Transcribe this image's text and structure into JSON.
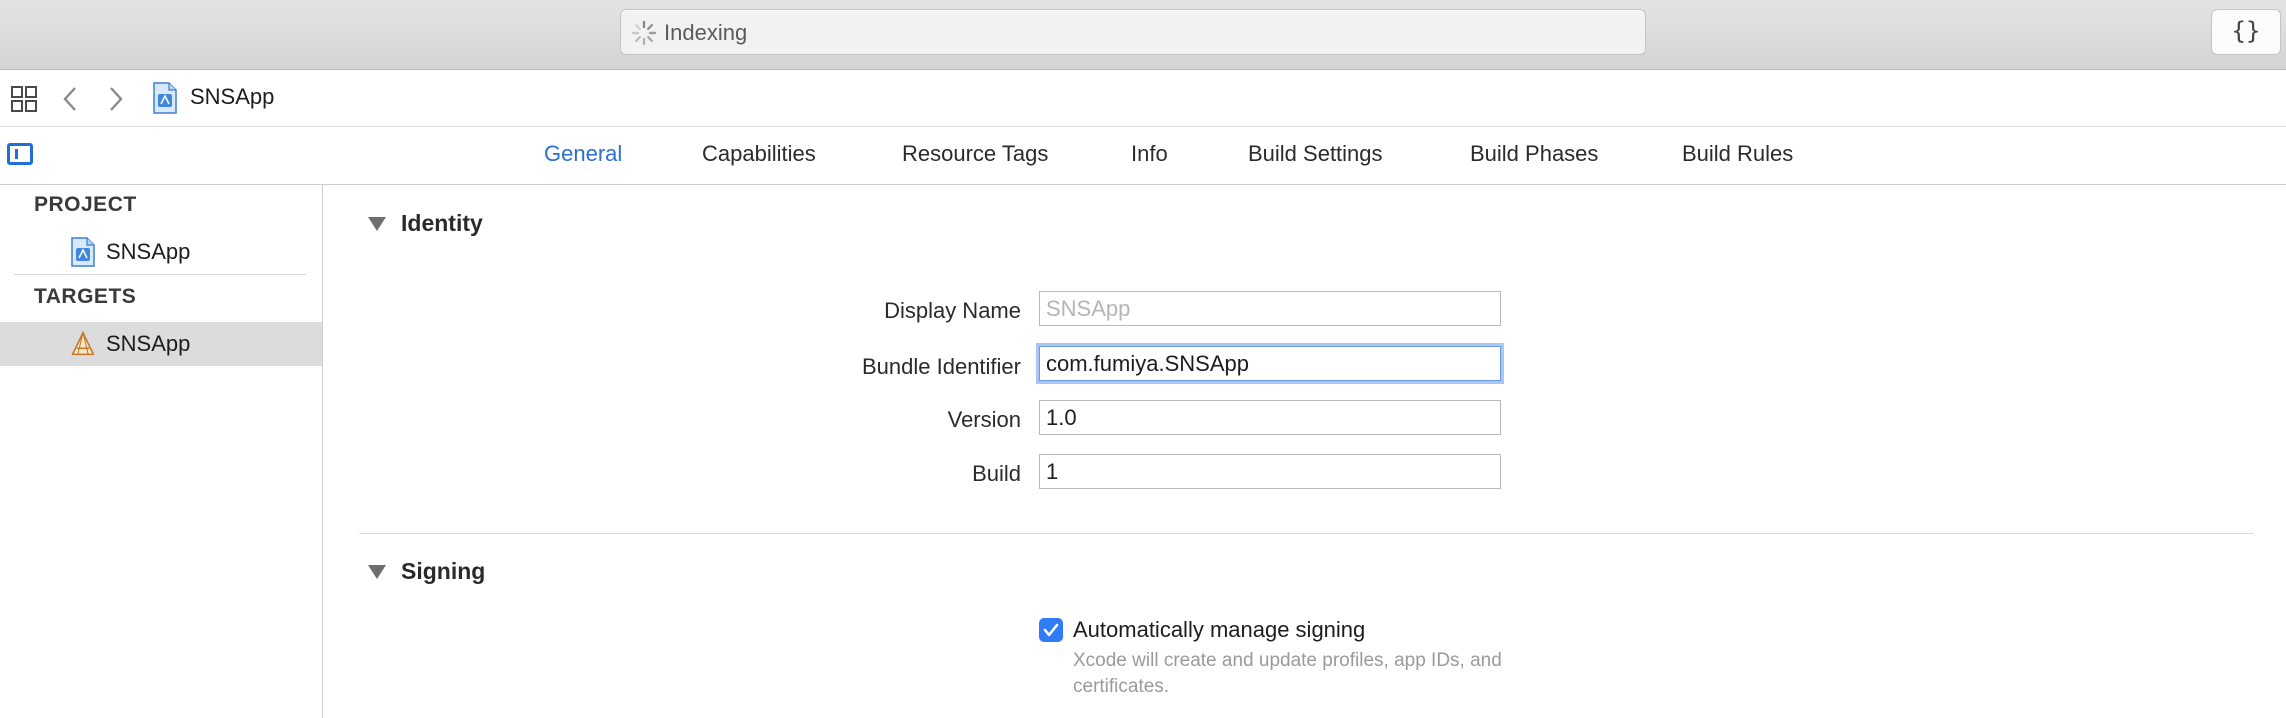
{
  "activity": {
    "status_text": "Indexing",
    "spinner_icon": "spinner-icon"
  },
  "toolbar": {
    "code_snippet_button": "{}"
  },
  "jumpbar": {
    "grid_icon": "related-items-grid-icon",
    "back_icon": "chevron-left-icon",
    "forward_icon": "chevron-right-icon",
    "file_icon": "xcodeproj-file-icon",
    "title": "SNSApp"
  },
  "tabs": {
    "sidebar_toggle_icon": "sidebar-toggle-icon",
    "items": [
      {
        "label": "General",
        "active": true
      },
      {
        "label": "Capabilities",
        "active": false
      },
      {
        "label": "Resource Tags",
        "active": false
      },
      {
        "label": "Info",
        "active": false
      },
      {
        "label": "Build Settings",
        "active": false
      },
      {
        "label": "Build Phases",
        "active": false
      },
      {
        "label": "Build Rules",
        "active": false
      }
    ],
    "active_color": "#2a6fd1"
  },
  "sidebar": {
    "project_header": "PROJECT",
    "project_item": {
      "label": "SNSApp",
      "icon": "xcodeproj-file-icon"
    },
    "targets_header": "TARGETS",
    "target_item": {
      "label": "SNSApp",
      "icon": "app-target-icon",
      "selected": true
    }
  },
  "identity": {
    "title": "Identity",
    "disclosure_icon": "disclosure-triangle-icon",
    "display_name": {
      "label": "Display Name",
      "value": "",
      "placeholder": "SNSApp"
    },
    "bundle_identifier": {
      "label": "Bundle Identifier",
      "value": "com.fumiya.SNSApp",
      "focused": true
    },
    "version": {
      "label": "Version",
      "value": "1.0"
    },
    "build": {
      "label": "Build",
      "value": "1"
    }
  },
  "signing": {
    "title": "Signing",
    "disclosure_icon": "disclosure-triangle-icon",
    "auto_manage": {
      "label": "Automatically manage signing",
      "checked": true,
      "description": "Xcode will create and update profiles, app IDs, and certificates."
    }
  },
  "colors": {
    "accent": "#2f7cf6",
    "focus_ring": "#a9c7f3",
    "selection": "#dcdcdc"
  }
}
